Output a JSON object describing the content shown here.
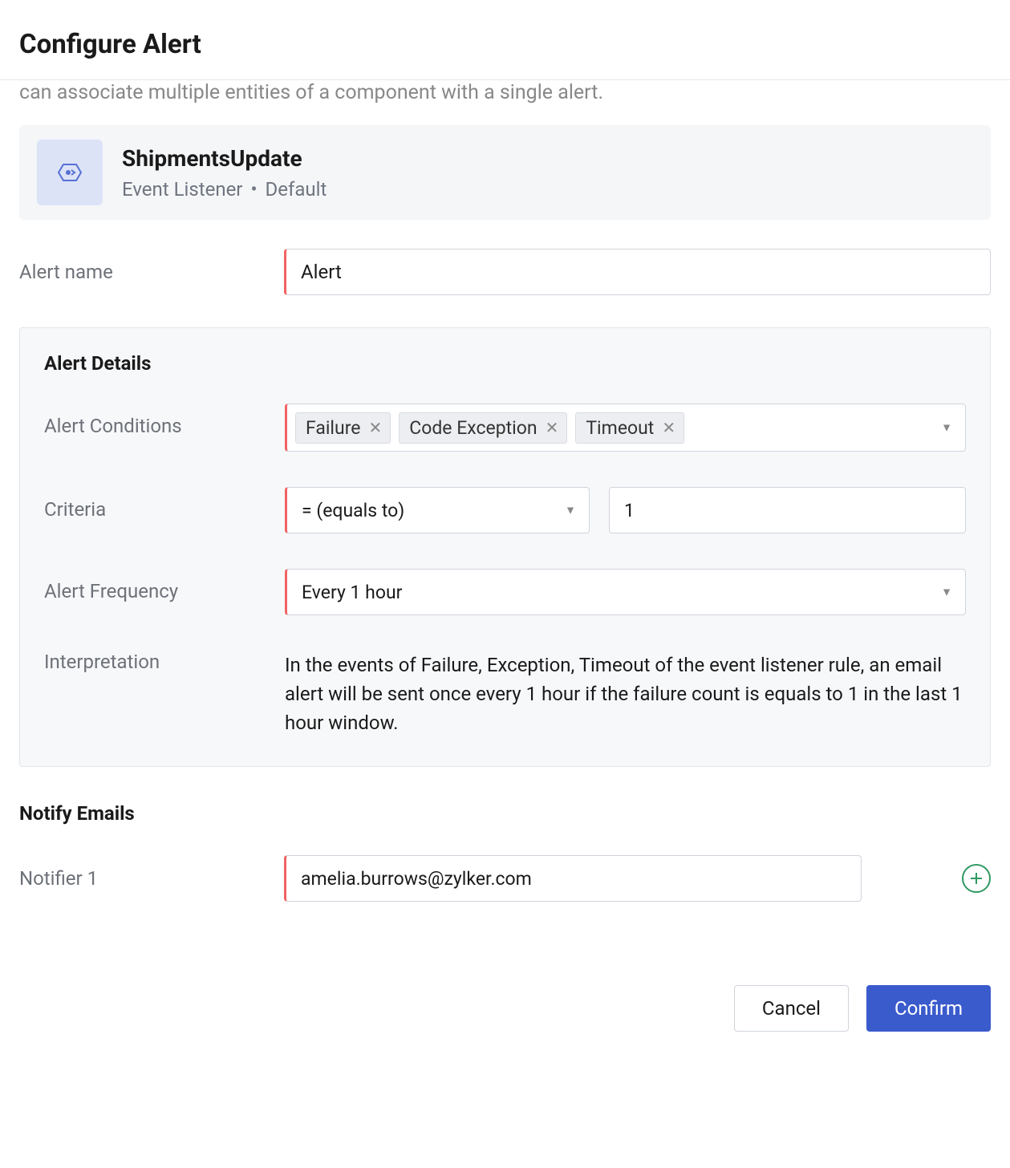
{
  "header": {
    "title": "Configure Alert"
  },
  "top_text": "can associate multiple entities of a component with a single alert.",
  "component": {
    "name": "ShipmentsUpdate",
    "type": "Event Listener",
    "scope": "Default"
  },
  "form": {
    "alert_name_label": "Alert name",
    "alert_name_value": "Alert"
  },
  "details": {
    "title": "Alert Details",
    "conditions_label": "Alert Conditions",
    "conditions": [
      "Failure",
      "Code Exception",
      "Timeout"
    ],
    "criteria_label": "Criteria",
    "criteria_operator": "= (equals to)",
    "criteria_value": "1",
    "frequency_label": "Alert Frequency",
    "frequency_value": "Every 1 hour",
    "interpretation_label": "Interpretation",
    "interpretation_text": "In the events of Failure, Exception, Timeout of the event listener rule, an email alert will be sent once every 1 hour if the failure count is equals to 1 in the last 1 hour window."
  },
  "notify": {
    "heading": "Notify Emails",
    "notifier1_label": "Notifier 1",
    "notifier1_value": "amelia.burrows@zylker.com"
  },
  "footer": {
    "cancel": "Cancel",
    "confirm": "Confirm"
  }
}
